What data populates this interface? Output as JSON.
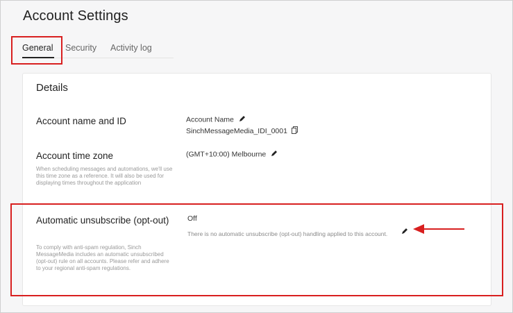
{
  "page_title": "Account Settings",
  "tabs": [
    {
      "label": "General",
      "active": true
    },
    {
      "label": "Security",
      "active": false
    },
    {
      "label": "Activity log",
      "active": false
    }
  ],
  "card": {
    "title": "Details",
    "rows": [
      {
        "label": "Account name and ID",
        "value_line1": "Account Name",
        "value_line2": "SinchMessageMedia_IDI_0001"
      },
      {
        "label": "Account time zone",
        "help": "When scheduling messages and automations, we'll use this time zone as a reference. It will also be used for displaying times throughout the application",
        "value": "(GMT+10:00) Melbourne"
      },
      {
        "label": "Automatic unsubscribe (opt-out)",
        "help": "To comply with anti-spam regulation, Sinch MessageMedia includes an automatic unsubscribed (opt-out) rule on all accounts. Please refer and adhere to your regional anti-spam regulations.",
        "value": "Off",
        "value_help": "There is no automatic unsubscribe (opt-out) handling applied to this account."
      }
    ]
  },
  "icons": {
    "edit": "pencil-icon",
    "copy": "copy-icon",
    "arrow": "arrow-left-icon"
  },
  "colors": {
    "highlight": "#d81f1f",
    "background": "#f6f6f7"
  }
}
